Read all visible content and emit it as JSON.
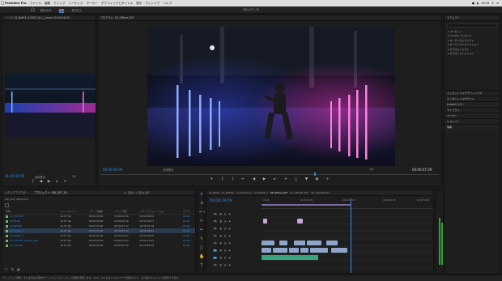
{
  "menubar": {
    "app": "Premiere Pro",
    "items": [
      "ファイル",
      "編集",
      "クリップ",
      "シーケンス",
      "マーカー",
      "グラフィックとタイトル",
      "表示",
      "ウィンドウ",
      "ヘルプ"
    ],
    "clock": "16:16"
  },
  "workspace": {
    "tabs": [
      "読み込み",
      "編集",
      "書き出し"
    ],
    "active_tab": "編集",
    "title": "SID_VOT_05"
  },
  "source": {
    "title": "ソース: 02_Baf04_3-0203_ALL_1.mov: 00:00:04:20",
    "timecode": "01:05:02:05",
    "fit": "全体表示",
    "zoom": "1/2"
  },
  "program": {
    "title": "プログラム: 05_Offline_E07",
    "timecode": "00:00:29:09",
    "fit": "全体表示",
    "zoom": "1/4",
    "duration": "00:00:47:29"
  },
  "effects": {
    "title": "エフェクト",
    "items": [
      "プリセット",
      "Lumetri プリセット",
      "オーディオエフェクト",
      "オーディオトランジション",
      "ビデオエフェクト",
      "ビデオトランジション"
    ],
    "sections": [
      "エッセンシャルグラフィックス",
      "エッセンシャルサウンド",
      "Lumetri カラー",
      "ライブラリ",
      "マーカー",
      "ヒストリー",
      "情報"
    ]
  },
  "project": {
    "tabs": [
      "メディアブラウザー",
      "プロジェクト: SID_VOT_05"
    ],
    "active_tab": "プロジェクト: SID_VOT_05",
    "file": "SID_VOT_05F.prproj",
    "count": "15 項目中 1 項目を選択",
    "columns": [
      "名前",
      "フレームレート",
      "メディア開始",
      "メディア終了",
      "メディアデュレーション",
      "ビデオ"
    ],
    "rows": [
      {
        "name": "01_TITLE03",
        "fps": "29.97 fps",
        "start": "00:00:00:00",
        "end": "00:00:04:29",
        "dur": "00:00:05:00",
        "v": "00:00",
        "color": "#6fbf5a"
      },
      {
        "name": "02_B006",
        "fps": "29.97 fps",
        "start": "00:00:00:00",
        "end": "00:00:06:12",
        "dur": "00:00:06:13",
        "v": "00:00",
        "color": "#6fbf5a"
      },
      {
        "name": "03_B003B",
        "fps": "29.97 fps",
        "start": "00:00:00:00",
        "end": "00:00:07:17",
        "dur": "00:00:07:18",
        "v": "00:00",
        "color": "#6fbf5a"
      },
      {
        "name": "02_Bdf03_2",
        "fps": "29.97 fps",
        "start": "00:00:00:00",
        "end": "00:00:04:20",
        "dur": "00:00:04:21",
        "v": "00:00",
        "color": "#6fbf5a"
      },
      {
        "name": "02_Bdf04_3",
        "fps": "29.97 fps",
        "start": "00:00:00:00",
        "end": "00:00:09:07",
        "dur": "00:00:09:08",
        "v": "00:00",
        "color": "#6fbf5a"
      },
      {
        "name": "03_Lotus01_CON_2.mp4",
        "fps": "29.97 fps",
        "start": "00:00:00:00",
        "end": "00:00:11:03",
        "dur": "00:00:11:04",
        "v": "00:00",
        "color": "#6fbf5a"
      },
      {
        "name": "03_Lotus02",
        "fps": "29.97 fps",
        "start": "00:00:00:00",
        "end": "00:00:08:15",
        "dur": "00:00:08:16",
        "v": "00:00",
        "color": "#6fbf5a"
      }
    ]
  },
  "timeline": {
    "tabs": [
      "00_B006",
      "01_Bdf030",
      "02_Bdf046_2",
      "03_Bdf04_3",
      "05_Offline_E07",
      "04_ONLINE_E07",
      "06_ONLINE_E07"
    ],
    "active_tab": "05_Offline_E07",
    "timecode": "00:00:29:09",
    "ruler": [
      "00:00",
      "00:00:14:29",
      "00:00:29:29",
      "00:00:44:28",
      "00:00:59:28"
    ],
    "tracks": [
      "V6",
      "V5",
      "V4",
      "V3",
      "V2",
      "V1",
      "A1",
      "A2"
    ]
  },
  "status": "クリックして選択、または空白の領域をクリックしてドラッグして範囲を選択します。Shift、Opt および Cmd キーを使用すると、その他のオプションを使用できます。"
}
